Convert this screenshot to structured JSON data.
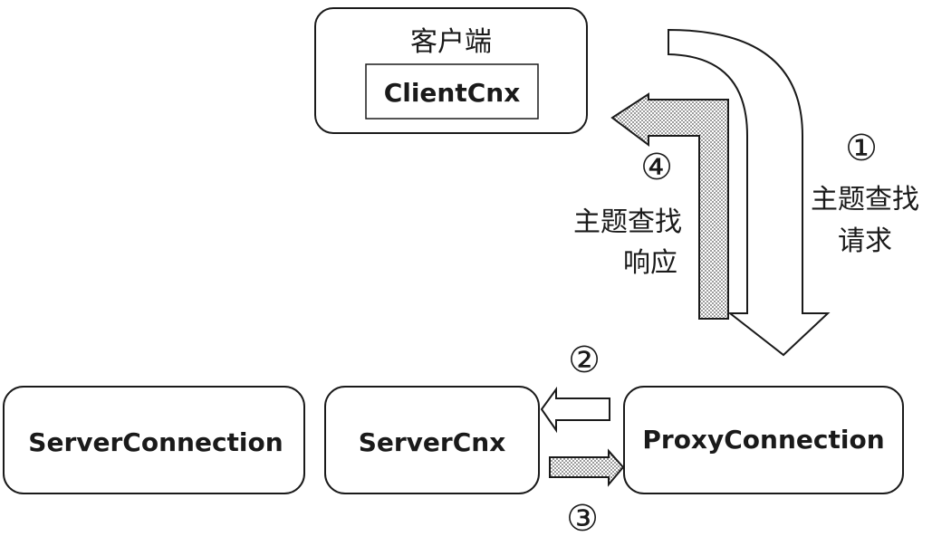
{
  "nodes": {
    "client": {
      "title": "客户端",
      "inner_label": "ClientCnx"
    },
    "server_connection": {
      "label": "ServerConnection"
    },
    "server_cnx": {
      "label": "ServerCnx"
    },
    "proxy_connection": {
      "label": "ProxyConnection"
    }
  },
  "steps": [
    {
      "number": "①",
      "line1": "主题查找",
      "line2": "请求"
    },
    {
      "number": "②"
    },
    {
      "number": "③"
    },
    {
      "number": "④",
      "line1": "主题查找",
      "line2": "响应"
    }
  ],
  "colors": {
    "stroke": "#1a1a1a",
    "box_fill": "#ffffff",
    "dotted_fill": "#b8b8b8"
  }
}
